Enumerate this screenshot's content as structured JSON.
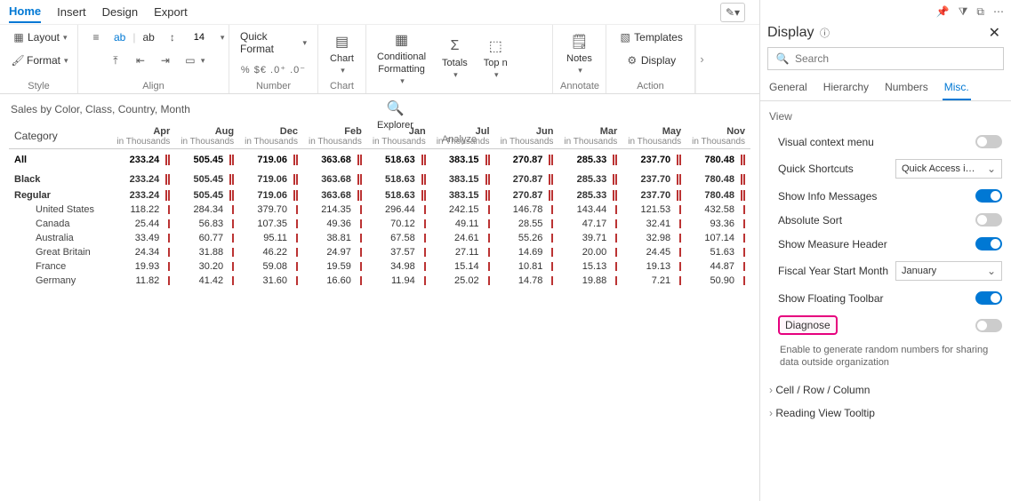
{
  "top_tabs": [
    "Home",
    "Insert",
    "Design",
    "Export"
  ],
  "active_top_tab": 0,
  "ribbon": {
    "style": {
      "layout": "Layout",
      "format": "Format",
      "label": "Style"
    },
    "align": {
      "label": "Align",
      "ab1": "ab",
      "ab2": "ab",
      "font_size": "14"
    },
    "number": {
      "quick_format": "Quick Format",
      "symbols": "% $€ .0⁺ .0⁻",
      "label": "Number"
    },
    "chart": {
      "btn": "Chart",
      "label": "Chart"
    },
    "analyze": {
      "conditional": "Conditional",
      "formatting": "Formatting",
      "totals": "Totals",
      "topn": "Top n",
      "explorer": "Explorer",
      "label": "Analyze"
    },
    "annotate": {
      "notes": "Notes",
      "label": "Annotate"
    },
    "action": {
      "templates": "Templates",
      "display": "Display",
      "label": "Action"
    }
  },
  "viz_title": "Sales by Color, Class, Country, Month",
  "table": {
    "row_header": "Category",
    "unit": "in Thousands",
    "months": [
      "Apr",
      "Aug",
      "Dec",
      "Feb",
      "Jan",
      "Jul",
      "Jun",
      "Mar",
      "May",
      "Nov"
    ],
    "rows": [
      {
        "type": "section",
        "label": "All",
        "vals": [
          "233.24",
          "505.45",
          "719.06",
          "363.68",
          "518.63",
          "383.15",
          "270.87",
          "285.33",
          "237.70",
          "780.48"
        ]
      },
      {
        "type": "sub1",
        "label": "Black",
        "vals": [
          "233.24",
          "505.45",
          "719.06",
          "363.68",
          "518.63",
          "383.15",
          "270.87",
          "285.33",
          "237.70",
          "780.48"
        ]
      },
      {
        "type": "sub2",
        "label": "Regular",
        "vals": [
          "233.24",
          "505.45",
          "719.06",
          "363.68",
          "518.63",
          "383.15",
          "270.87",
          "285.33",
          "237.70",
          "780.48"
        ]
      },
      {
        "type": "leaf",
        "label": "United States",
        "vals": [
          "118.22",
          "284.34",
          "379.70",
          "214.35",
          "296.44",
          "242.15",
          "146.78",
          "143.44",
          "121.53",
          "432.58"
        ]
      },
      {
        "type": "leaf",
        "label": "Canada",
        "vals": [
          "25.44",
          "56.83",
          "107.35",
          "49.36",
          "70.12",
          "49.11",
          "28.55",
          "47.17",
          "32.41",
          "93.36"
        ]
      },
      {
        "type": "leaf",
        "label": "Australia",
        "vals": [
          "33.49",
          "60.77",
          "95.11",
          "38.81",
          "67.58",
          "24.61",
          "55.26",
          "39.71",
          "32.98",
          "107.14"
        ]
      },
      {
        "type": "leaf",
        "label": "Great Britain",
        "vals": [
          "24.34",
          "31.88",
          "46.22",
          "24.97",
          "37.57",
          "27.11",
          "14.69",
          "20.00",
          "24.45",
          "51.63"
        ]
      },
      {
        "type": "leaf",
        "label": "France",
        "vals": [
          "19.93",
          "30.20",
          "59.08",
          "19.59",
          "34.98",
          "15.14",
          "10.81",
          "15.13",
          "19.13",
          "44.87"
        ]
      },
      {
        "type": "leaf",
        "label": "Germany",
        "vals": [
          "11.82",
          "41.42",
          "31.60",
          "16.60",
          "11.94",
          "25.02",
          "14.78",
          "19.88",
          "7.21",
          "50.90"
        ]
      }
    ]
  },
  "panel": {
    "title": "Display",
    "search_placeholder": "Search",
    "tabs": [
      "General",
      "Hierarchy",
      "Numbers",
      "Misc."
    ],
    "active_tab": 3,
    "view_label": "View",
    "opts": {
      "visual_context": "Visual context menu",
      "quick_shortcuts": "Quick Shortcuts",
      "quick_shortcuts_value": "Quick Access i…",
      "show_info": "Show Info Messages",
      "absolute_sort": "Absolute Sort",
      "show_measure_header": "Show Measure Header",
      "fiscal_year": "Fiscal Year Start Month",
      "fiscal_year_value": "January",
      "show_floating_toolbar": "Show Floating Toolbar",
      "diagnose": "Diagnose",
      "diagnose_help": "Enable to generate random numbers for sharing data outside organization"
    },
    "collapse1": "Cell / Row / Column",
    "collapse2": "Reading View Tooltip"
  }
}
